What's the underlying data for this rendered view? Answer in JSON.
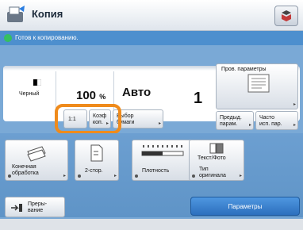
{
  "window": {
    "title": "Копия"
  },
  "status": {
    "text": "Готов к копированию."
  },
  "settings": {
    "color": "Черный",
    "ratio_value": "100",
    "ratio_unit": "%",
    "paper": "Авто",
    "copies": "1"
  },
  "buttons": {
    "ratio_11": "1:1",
    "ratio": "Коэф\nкоп.",
    "paper_select": "Выбор\nбумаги",
    "check_settings": "Пров. параметры",
    "favorites": "Предыд.\nпарам.",
    "frequent": "Часто\nисп. пар.",
    "finishing": "Конечная\nобработка",
    "duplex": "2-стор.",
    "density": "Плотность",
    "original_type": "Текст/Фото",
    "original_type_label": "Тип\nоригинала",
    "interrupt": "Преры-\nвание",
    "options": "Параметры"
  },
  "colors": {
    "accent": "#4d8fce",
    "highlight": "#ef8b1c",
    "status_ok": "#35c060"
  },
  "icons": [
    "copy-icon",
    "menu-icon",
    "status-ok-icon",
    "finishing-icon",
    "duplex-icon",
    "density-icon",
    "original-type-icon",
    "interrupt-icon"
  ]
}
